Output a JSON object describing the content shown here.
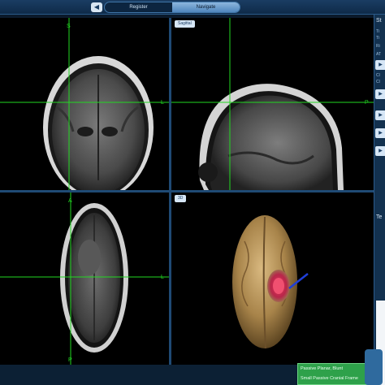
{
  "top_bar": {
    "back_icon": "back-arrow-icon",
    "tabs": [
      {
        "label": "Register",
        "active": false
      },
      {
        "label": "Navigate",
        "active": true
      }
    ]
  },
  "viewports": {
    "coronal": {
      "button": "",
      "axis_top": "S",
      "axis_right": "L",
      "axis_bottom": "I",
      "axis_left": ""
    },
    "sagittal": {
      "button": "Sagittal",
      "axis_left": "A",
      "axis_right": "P"
    },
    "axial": {
      "button": "",
      "axis_top": "A",
      "axis_right": "L",
      "axis_bottom": "P"
    },
    "volume_3d": {
      "button": "3D"
    }
  },
  "right_panel": {
    "title": "St",
    "lines": [
      "Ti",
      "Ti",
      "Ri",
      "AT",
      "Cl",
      "Cl"
    ],
    "section_title": "Te"
  },
  "status": {
    "line1": "Passive Planar, Blunt",
    "line2": "Small Passive Cranial Frame",
    "color": "#2ea14a"
  }
}
